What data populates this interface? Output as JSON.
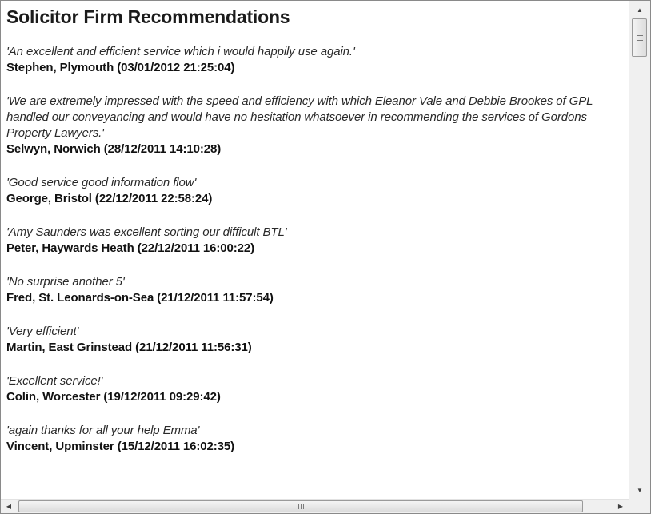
{
  "page": {
    "title": "Solicitor Firm Recommendations"
  },
  "reviews": [
    {
      "quote": "'An excellent and efficient service which i would happily use again.'",
      "author": "Stephen, Plymouth (03/01/2012 21:25:04)"
    },
    {
      "quote": "'We are extremely impressed with the speed and efficiency with which Eleanor Vale and Debbie Brookes of GPL handled our conveyancing and would have no hesitation whatsoever in recommending the services of Gordons Property Lawyers.'",
      "author": "Selwyn, Norwich (28/12/2011 14:10:28)"
    },
    {
      "quote": "'Good service good information flow'",
      "author": "George, Bristol (22/12/2011 22:58:24)"
    },
    {
      "quote": "'Amy Saunders was excellent sorting our difficult BTL'",
      "author": "Peter, Haywards Heath (22/12/2011 16:00:22)"
    },
    {
      "quote": "'No surprise another 5'",
      "author": "Fred, St. Leonards-on-Sea (21/12/2011 11:57:54)"
    },
    {
      "quote": "'Very efficient'",
      "author": "Martin, East Grinstead (21/12/2011 11:56:31)"
    },
    {
      "quote": "'Excellent service!'",
      "author": "Colin, Worcester (19/12/2011 09:29:42)"
    },
    {
      "quote": "'again thanks for all your help Emma'",
      "author": "Vincent, Upminster (15/12/2011 16:02:35)"
    }
  ],
  "scrollbars": {
    "vertical": {
      "up_icon": "chevron-up-icon",
      "down_icon": "chevron-down-icon",
      "up_glyph": "▲",
      "down_glyph": "▼"
    },
    "horizontal": {
      "left_icon": "chevron-left-icon",
      "right_icon": "chevron-right-icon",
      "left_glyph": "◀",
      "right_glyph": "▶"
    }
  }
}
